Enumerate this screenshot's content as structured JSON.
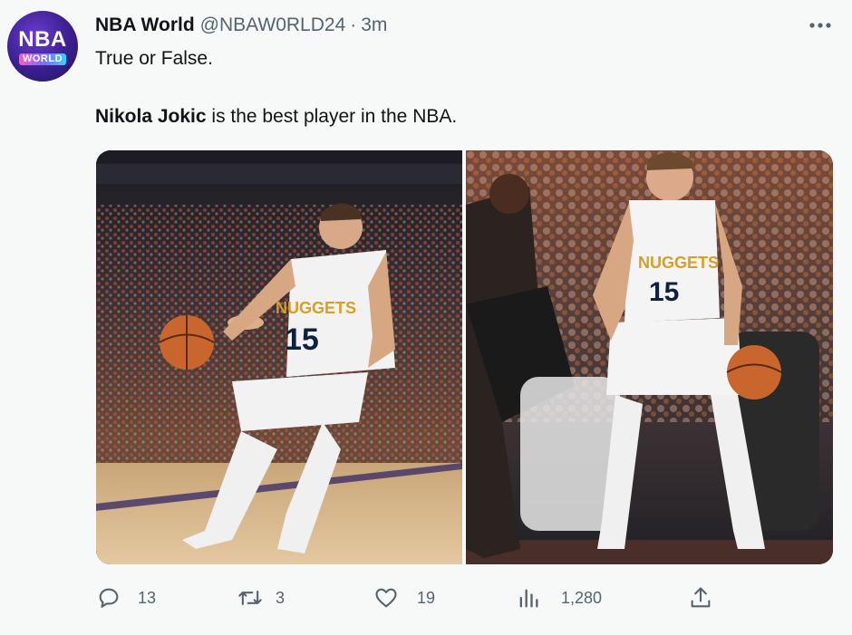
{
  "tweet": {
    "avatar": {
      "line1": "NBA",
      "line2": "WORLD"
    },
    "author_name": "NBA World",
    "handle": "@NBAW0RLD24",
    "separator": "·",
    "time": "3m",
    "text_line1": "True or False.",
    "text_line2_bold": "Nikola Jokic",
    "text_line2_rest": " is the best player in the NBA.",
    "more_icon": "ellipsis-icon"
  },
  "media": {
    "left_jersey": {
      "team": "NUGGETS",
      "number": "15"
    },
    "right_jersey": {
      "team": "NUGGETS",
      "number": "15"
    }
  },
  "actions": {
    "replies": "13",
    "retweets": "3",
    "likes": "19",
    "views": "1,280"
  },
  "colors": {
    "background": "#f7f9f9",
    "text": "#0f1419",
    "secondary": "#536471",
    "jersey_gold": "#d4a02a",
    "jersey_text": "#0e2240"
  }
}
